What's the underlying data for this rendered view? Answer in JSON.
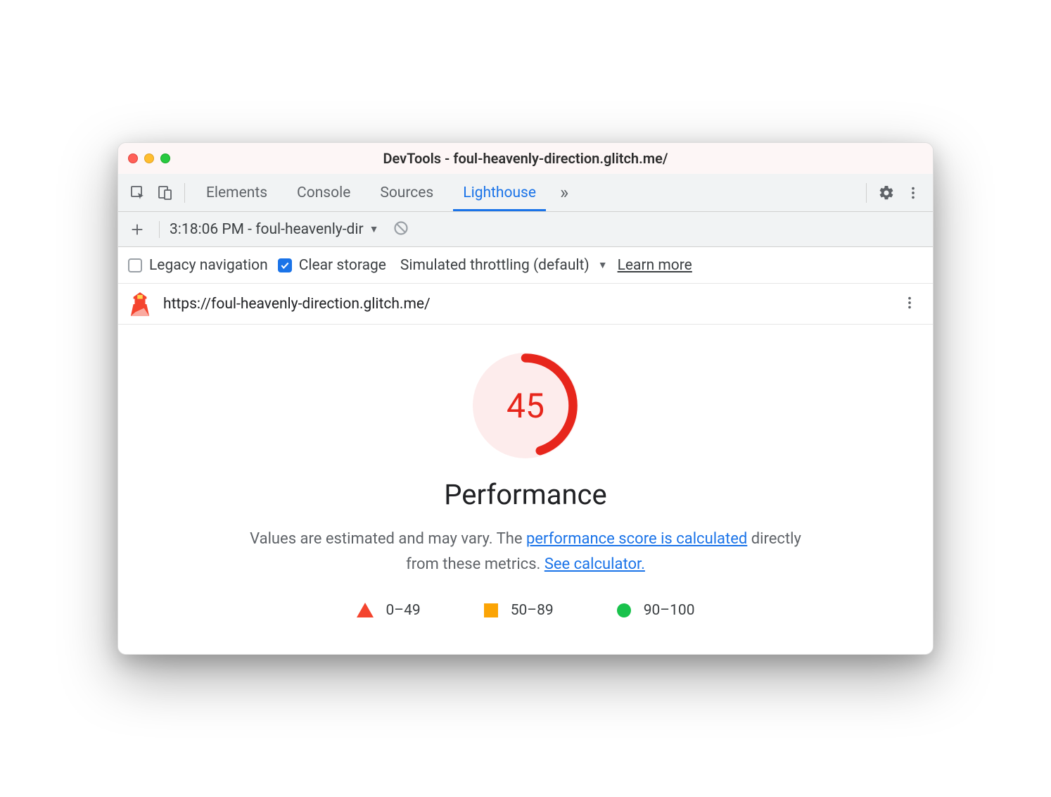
{
  "window": {
    "title": "DevTools - foul-heavenly-direction.glitch.me/"
  },
  "tabs": {
    "items": [
      "Elements",
      "Console",
      "Sources",
      "Lighthouse"
    ],
    "more_glyph": "»"
  },
  "subtoolbar": {
    "report_label": "3:18:06 PM - foul-heavenly-dir"
  },
  "options": {
    "legacy_nav": "Legacy navigation",
    "clear_storage": "Clear storage",
    "throttling": "Simulated throttling (default)",
    "learn_more": "Learn more"
  },
  "url_row": {
    "url": "https://foul-heavenly-direction.glitch.me/"
  },
  "report": {
    "score": "45",
    "title": "Performance",
    "desc_pre": "Values are estimated and may vary. The ",
    "link1": "performance score is calculated",
    "desc_mid": " directly from these metrics. ",
    "link2": "See calculator.",
    "legend": {
      "r1": "0–49",
      "r2": "50–89",
      "r3": "90–100"
    }
  },
  "chart_data": {
    "type": "pie",
    "title": "Performance",
    "values": [
      45
    ],
    "categories": [
      "Performance score"
    ],
    "ylim": [
      0,
      100
    ],
    "legend_ranges": [
      {
        "label": "0–49",
        "color": "#f4442e",
        "shape": "triangle"
      },
      {
        "label": "50–89",
        "color": "#fba405",
        "shape": "square"
      },
      {
        "label": "90–100",
        "color": "#19c24c",
        "shape": "circle"
      }
    ]
  }
}
